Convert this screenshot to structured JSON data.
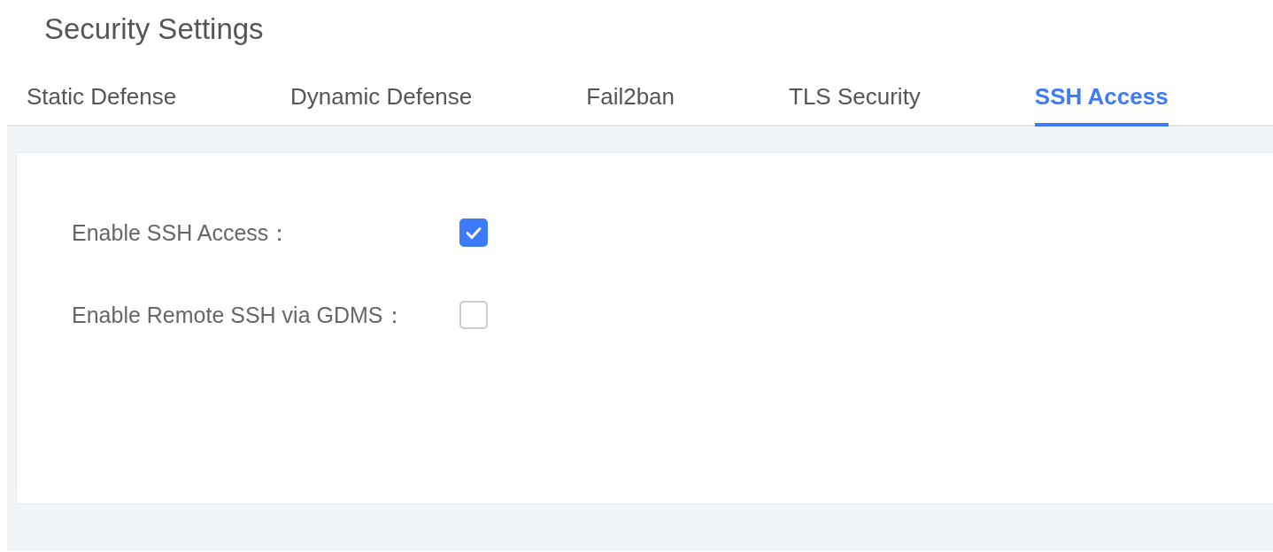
{
  "page": {
    "title": "Security Settings"
  },
  "tabs": [
    {
      "label": "Static Defense",
      "selected": false
    },
    {
      "label": "Dynamic Defense",
      "selected": false
    },
    {
      "label": "Fail2ban",
      "selected": false
    },
    {
      "label": "TLS Security",
      "selected": false
    },
    {
      "label": "SSH Access",
      "selected": true
    }
  ],
  "settings": [
    {
      "label": "Enable SSH Access：",
      "checked": true
    },
    {
      "label": "Enable Remote SSH via GDMS：",
      "checked": false
    }
  ]
}
